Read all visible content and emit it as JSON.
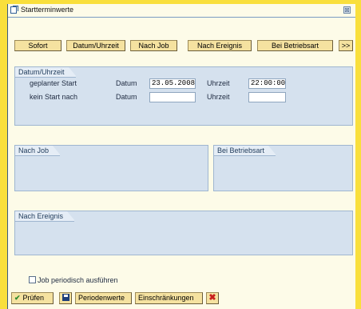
{
  "window": {
    "title": "Startterminwerte",
    "close_symbol": "⊠"
  },
  "buttons": {
    "sofort": "Sofort",
    "datum_uhrzeit": "Datum/Uhrzeit",
    "nach_job": "Nach Job",
    "nach_ereignis": "Nach Ereignis",
    "bei_betriebsart": "Bei Betriebsart",
    "more": ">>"
  },
  "datum_panel": {
    "title": "Datum/Uhrzeit",
    "row1_label": "geplanter Start",
    "row2_label": "kein Start nach",
    "datum_label": "Datum",
    "uhrzeit_label": "Uhrzeit",
    "start_date": "23.05.2008",
    "start_time": "22:00:00",
    "no_start_date": "",
    "no_start_time": ""
  },
  "panels": {
    "nach_job": "Nach Job",
    "bei_betriebsart": "Bei Betriebsart",
    "nach_ereignis": "Nach Ereignis"
  },
  "periodic": {
    "label": "Job periodisch ausführen",
    "checked": false
  },
  "toolbar": {
    "pruefen": "Prüfen",
    "periodenwerte": "Periodenwerte",
    "einschraenkungen": "Einschränkungen"
  },
  "icons": {
    "title": "popup-window-icon",
    "check": "checkmark-icon",
    "save": "save-icon",
    "cancel": "cancel-icon"
  },
  "colors": {
    "background": "#f9df3c",
    "window": "#fdfbe8",
    "panel": "#d5e1ee",
    "button": "#f5e2a0"
  }
}
